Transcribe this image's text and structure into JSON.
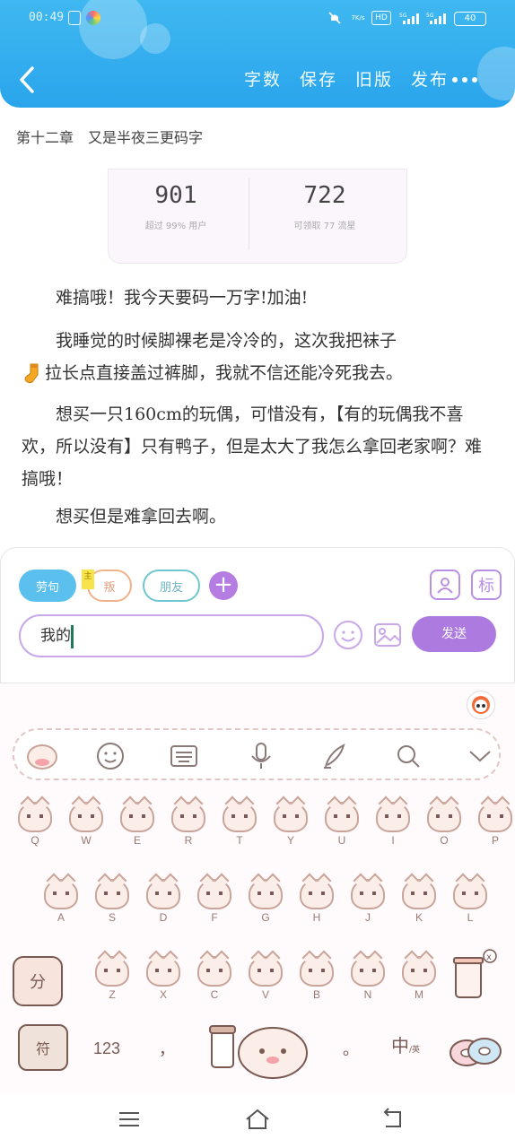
{
  "status": {
    "time": "00:49",
    "speed": "7K/s",
    "battery": "40"
  },
  "header": {
    "actions": [
      "字数",
      "保存",
      "旧版",
      "发布"
    ]
  },
  "chapter_title": "第十二章　又是半夜三更码字",
  "stats": {
    "left": {
      "num": "901",
      "sub": "超过 99% 用户"
    },
    "right": {
      "num": "722",
      "sub": "可领取 77 流星"
    }
  },
  "paragraphs": [
    "难搞哦！我今天要码一万字!加油!",
    "我睡觉的时候脚裸老是冷冷的，这次我把袜子",
    "拉长点直接盖过裤脚，我就不信还能冷死我去。",
    "想买一只160cm的玩偶，可惜没有，【有的玩偶我不喜欢，所以没有】只有鸭子，但是太大了我怎么拿回老家啊？难搞哦！",
    "想买但是难拿回去啊。"
  ],
  "comment": {
    "tags": [
      "劳句",
      "叛",
      "朋友"
    ],
    "sticky": "主",
    "input_value": "我的",
    "send": "发送",
    "right_icon": "标"
  },
  "keyboard": {
    "row1": [
      "Q",
      "W",
      "E",
      "R",
      "T",
      "Y",
      "U",
      "I",
      "O",
      "P"
    ],
    "row2": [
      "A",
      "S",
      "D",
      "F",
      "G",
      "H",
      "J",
      "K",
      "L"
    ],
    "row3": [
      "Z",
      "X",
      "C",
      "V",
      "B",
      "N",
      "M"
    ],
    "fen": "分",
    "fu": "符",
    "num": "123",
    "comma": "，",
    "period": "。",
    "lang": "中",
    "lang_sub": "/英"
  }
}
